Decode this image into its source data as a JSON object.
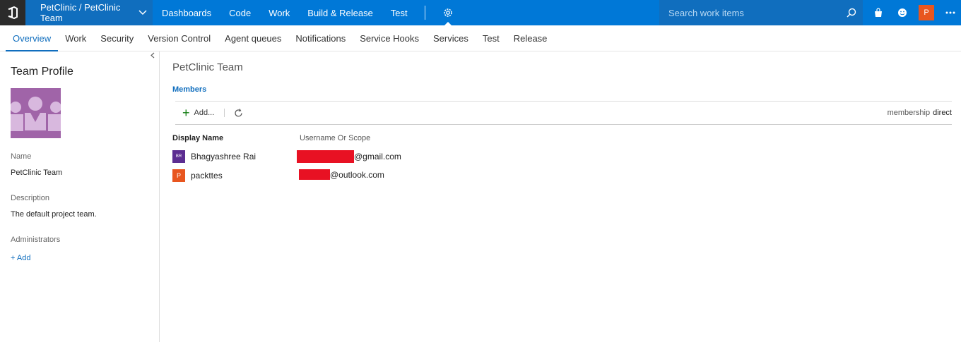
{
  "topbar": {
    "project": "PetClinic / PetClinic Team",
    "nav": [
      "Dashboards",
      "Code",
      "Work",
      "Build & Release",
      "Test"
    ],
    "search_placeholder": "Search work items",
    "user_initial": "P"
  },
  "tabs": [
    "Overview",
    "Work",
    "Security",
    "Version Control",
    "Agent queues",
    "Notifications",
    "Service Hooks",
    "Services",
    "Test",
    "Release"
  ],
  "left": {
    "title": "Team Profile",
    "name_label": "Name",
    "name_value": "PetClinic Team",
    "description_label": "Description",
    "description_value": "The default project team.",
    "admins_label": "Administrators",
    "add_label": "+ Add"
  },
  "main": {
    "team_title": "PetClinic Team",
    "members_heading": "Members",
    "add_label": "Add...",
    "membership_label": "membership",
    "membership_value": "direct",
    "col_display": "Display Name",
    "col_username": "Username Or Scope",
    "members": [
      {
        "initials": "BR",
        "name": "Bhagyashree Rai",
        "email_suffix": "@gmail.com",
        "avatar_color": "#5c2d91"
      },
      {
        "initials": "P",
        "name": "packttes",
        "email_suffix": "@outlook.com",
        "avatar_color": "#e8561f"
      }
    ]
  },
  "colors": {
    "accent": "#0078d7",
    "redaction": "#e81123"
  }
}
